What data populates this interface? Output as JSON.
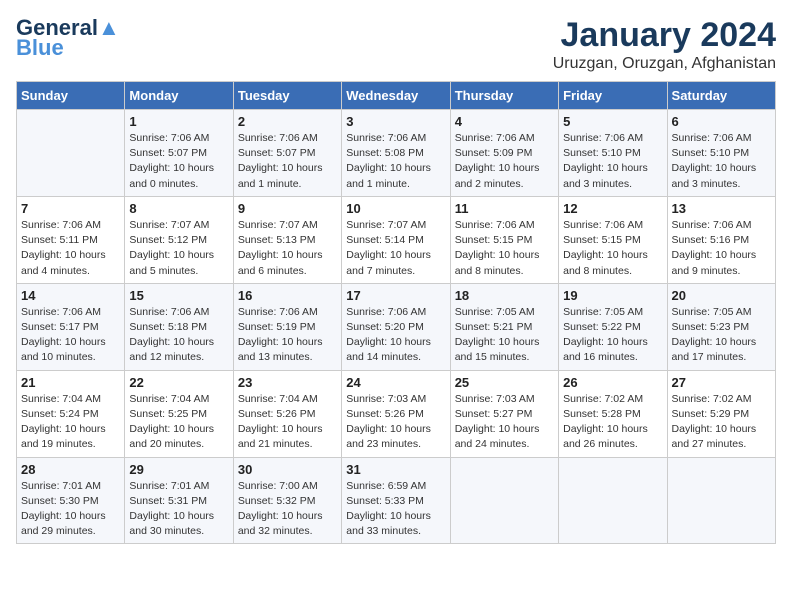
{
  "header": {
    "logo_line1": "General",
    "logo_line2": "Blue",
    "month": "January 2024",
    "location": "Uruzgan, Oruzgan, Afghanistan"
  },
  "weekdays": [
    "Sunday",
    "Monday",
    "Tuesday",
    "Wednesday",
    "Thursday",
    "Friday",
    "Saturday"
  ],
  "weeks": [
    [
      {
        "day": "",
        "info": ""
      },
      {
        "day": "1",
        "info": "Sunrise: 7:06 AM\nSunset: 5:07 PM\nDaylight: 10 hours\nand 0 minutes."
      },
      {
        "day": "2",
        "info": "Sunrise: 7:06 AM\nSunset: 5:07 PM\nDaylight: 10 hours\nand 1 minute."
      },
      {
        "day": "3",
        "info": "Sunrise: 7:06 AM\nSunset: 5:08 PM\nDaylight: 10 hours\nand 1 minute."
      },
      {
        "day": "4",
        "info": "Sunrise: 7:06 AM\nSunset: 5:09 PM\nDaylight: 10 hours\nand 2 minutes."
      },
      {
        "day": "5",
        "info": "Sunrise: 7:06 AM\nSunset: 5:10 PM\nDaylight: 10 hours\nand 3 minutes."
      },
      {
        "day": "6",
        "info": "Sunrise: 7:06 AM\nSunset: 5:10 PM\nDaylight: 10 hours\nand 3 minutes."
      }
    ],
    [
      {
        "day": "7",
        "info": "Sunrise: 7:06 AM\nSunset: 5:11 PM\nDaylight: 10 hours\nand 4 minutes."
      },
      {
        "day": "8",
        "info": "Sunrise: 7:07 AM\nSunset: 5:12 PM\nDaylight: 10 hours\nand 5 minutes."
      },
      {
        "day": "9",
        "info": "Sunrise: 7:07 AM\nSunset: 5:13 PM\nDaylight: 10 hours\nand 6 minutes."
      },
      {
        "day": "10",
        "info": "Sunrise: 7:07 AM\nSunset: 5:14 PM\nDaylight: 10 hours\nand 7 minutes."
      },
      {
        "day": "11",
        "info": "Sunrise: 7:06 AM\nSunset: 5:15 PM\nDaylight: 10 hours\nand 8 minutes."
      },
      {
        "day": "12",
        "info": "Sunrise: 7:06 AM\nSunset: 5:15 PM\nDaylight: 10 hours\nand 8 minutes."
      },
      {
        "day": "13",
        "info": "Sunrise: 7:06 AM\nSunset: 5:16 PM\nDaylight: 10 hours\nand 9 minutes."
      }
    ],
    [
      {
        "day": "14",
        "info": "Sunrise: 7:06 AM\nSunset: 5:17 PM\nDaylight: 10 hours\nand 10 minutes."
      },
      {
        "day": "15",
        "info": "Sunrise: 7:06 AM\nSunset: 5:18 PM\nDaylight: 10 hours\nand 12 minutes."
      },
      {
        "day": "16",
        "info": "Sunrise: 7:06 AM\nSunset: 5:19 PM\nDaylight: 10 hours\nand 13 minutes."
      },
      {
        "day": "17",
        "info": "Sunrise: 7:06 AM\nSunset: 5:20 PM\nDaylight: 10 hours\nand 14 minutes."
      },
      {
        "day": "18",
        "info": "Sunrise: 7:05 AM\nSunset: 5:21 PM\nDaylight: 10 hours\nand 15 minutes."
      },
      {
        "day": "19",
        "info": "Sunrise: 7:05 AM\nSunset: 5:22 PM\nDaylight: 10 hours\nand 16 minutes."
      },
      {
        "day": "20",
        "info": "Sunrise: 7:05 AM\nSunset: 5:23 PM\nDaylight: 10 hours\nand 17 minutes."
      }
    ],
    [
      {
        "day": "21",
        "info": "Sunrise: 7:04 AM\nSunset: 5:24 PM\nDaylight: 10 hours\nand 19 minutes."
      },
      {
        "day": "22",
        "info": "Sunrise: 7:04 AM\nSunset: 5:25 PM\nDaylight: 10 hours\nand 20 minutes."
      },
      {
        "day": "23",
        "info": "Sunrise: 7:04 AM\nSunset: 5:26 PM\nDaylight: 10 hours\nand 21 minutes."
      },
      {
        "day": "24",
        "info": "Sunrise: 7:03 AM\nSunset: 5:26 PM\nDaylight: 10 hours\nand 23 minutes."
      },
      {
        "day": "25",
        "info": "Sunrise: 7:03 AM\nSunset: 5:27 PM\nDaylight: 10 hours\nand 24 minutes."
      },
      {
        "day": "26",
        "info": "Sunrise: 7:02 AM\nSunset: 5:28 PM\nDaylight: 10 hours\nand 26 minutes."
      },
      {
        "day": "27",
        "info": "Sunrise: 7:02 AM\nSunset: 5:29 PM\nDaylight: 10 hours\nand 27 minutes."
      }
    ],
    [
      {
        "day": "28",
        "info": "Sunrise: 7:01 AM\nSunset: 5:30 PM\nDaylight: 10 hours\nand 29 minutes."
      },
      {
        "day": "29",
        "info": "Sunrise: 7:01 AM\nSunset: 5:31 PM\nDaylight: 10 hours\nand 30 minutes."
      },
      {
        "day": "30",
        "info": "Sunrise: 7:00 AM\nSunset: 5:32 PM\nDaylight: 10 hours\nand 32 minutes."
      },
      {
        "day": "31",
        "info": "Sunrise: 6:59 AM\nSunset: 5:33 PM\nDaylight: 10 hours\nand 33 minutes."
      },
      {
        "day": "",
        "info": ""
      },
      {
        "day": "",
        "info": ""
      },
      {
        "day": "",
        "info": ""
      }
    ]
  ]
}
